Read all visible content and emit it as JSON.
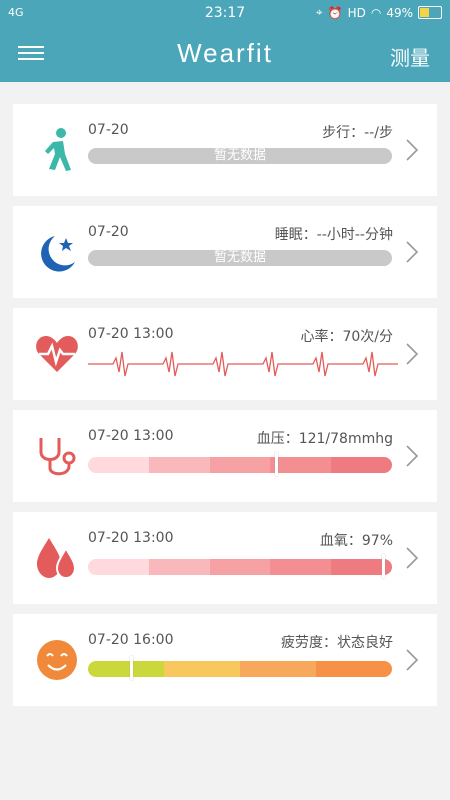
{
  "status_bar": {
    "network": "4G",
    "time": "23:17",
    "hd": "HD",
    "battery": "49%"
  },
  "header": {
    "title": "Wearfit",
    "measure_label": "测量"
  },
  "colors": {
    "header": "#4aa6b8",
    "steps_icon": "#3bb8a9",
    "sleep_icon": "#1e63b4",
    "health_icon": "#e35b5b",
    "fatigue_icon": "#f08a3a"
  },
  "cards": {
    "steps": {
      "date": "07-20",
      "value": "步行：--/步",
      "empty_label": "暂无数据",
      "icon": "walking-person-icon"
    },
    "sleep": {
      "date": "07-20",
      "value": "睡眠：--小时--分钟",
      "empty_label": "暂无数据",
      "icon": "moon-star-icon"
    },
    "heart": {
      "date": "07-20 13:00",
      "value": "心率：70次/分",
      "icon": "heart-pulse-icon"
    },
    "pressure": {
      "date": "07-20 13:00",
      "value": "血压：121/78mmhg",
      "icon": "stethoscope-icon",
      "level": 0.62,
      "segments": [
        "#ffd9dc",
        "#f9b8bb",
        "#f6a2a5",
        "#f38f92",
        "#ee7b7f"
      ]
    },
    "oxygen": {
      "date": "07-20 13:00",
      "value": "血氧：97%",
      "icon": "blood-drops-icon",
      "level": 0.97,
      "segments": [
        "#ffd9dc",
        "#f9b8bb",
        "#f6a2a5",
        "#f38f92",
        "#ee7b7f"
      ]
    },
    "fatigue": {
      "date": "07-20 16:00",
      "value": "疲劳度：状态良好",
      "icon": "smiley-face-icon",
      "level": 0.14,
      "segments": [
        "#cbd83c",
        "#f8c75d",
        "#f7a85a",
        "#f69146"
      ]
    }
  }
}
